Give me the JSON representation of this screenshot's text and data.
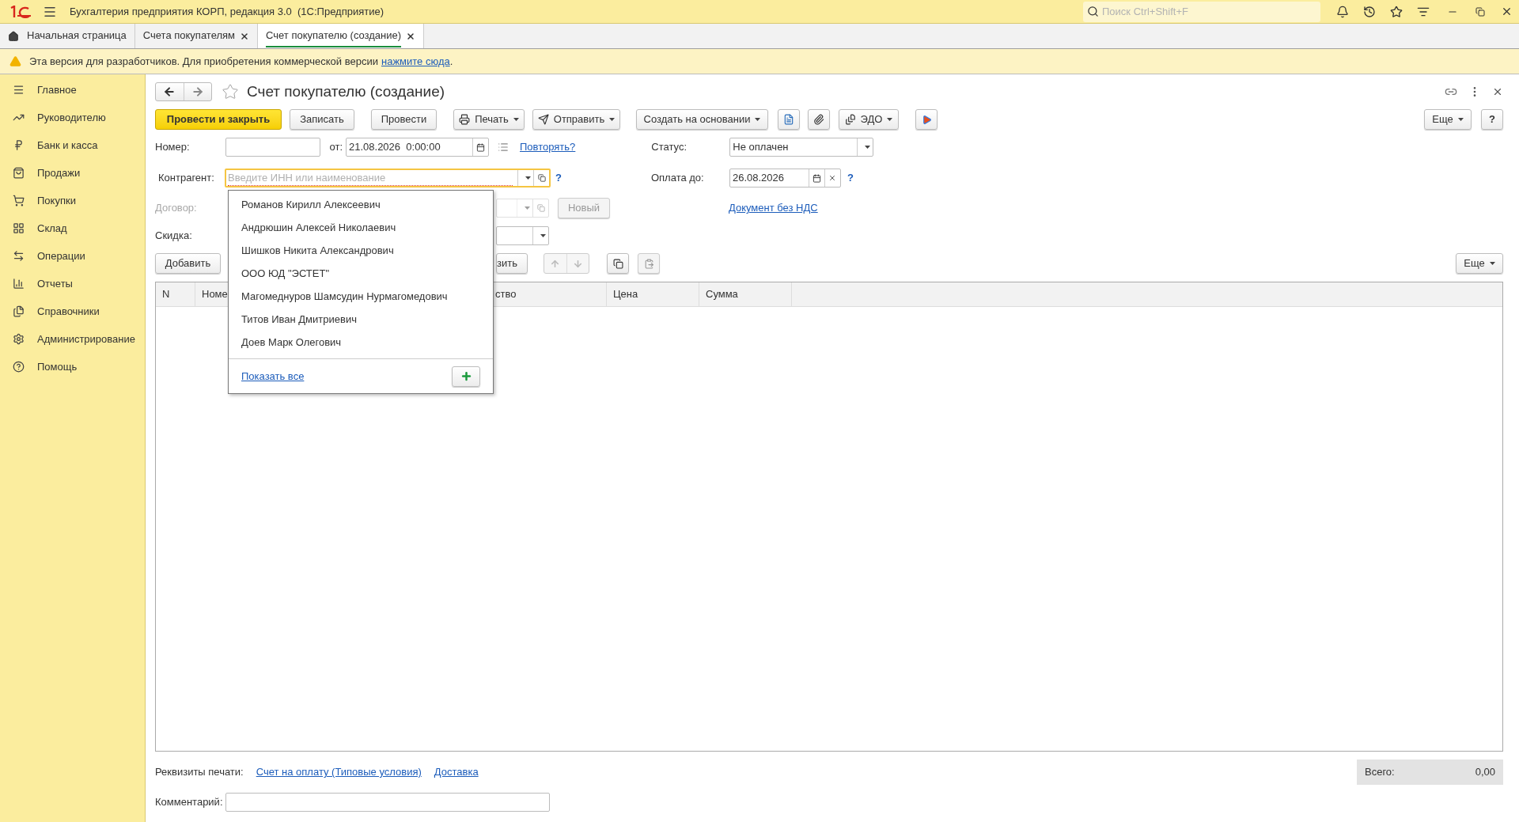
{
  "app": {
    "title": "Бухгалтерия предприятия КОРП, редакция 3.0  (1С:Предприятие)",
    "search": {
      "placeholder": "Поиск Ctrl+Shift+F"
    }
  },
  "tabs": [
    {
      "label": "Начальная страница",
      "selected": false,
      "closable": false
    },
    {
      "label": "Счета покупателям",
      "selected": false,
      "closable": true
    },
    {
      "label": "Счет покупателю (создание)",
      "selected": true,
      "closable": true
    }
  ],
  "notice": {
    "text": "Эта версия для разработчиков. Для приобретения коммерческой версии",
    "link": "нажмите сюда",
    "end": "."
  },
  "sidebar": {
    "items": [
      {
        "label": "Главное"
      },
      {
        "label": "Руководителю"
      },
      {
        "label": "Банк и касса"
      },
      {
        "label": "Продажи"
      },
      {
        "label": "Покупки"
      },
      {
        "label": "Склад"
      },
      {
        "label": "Операции"
      },
      {
        "label": "Отчеты"
      },
      {
        "label": "Справочники"
      },
      {
        "label": "Администрирование"
      },
      {
        "label": "Помощь"
      }
    ]
  },
  "form": {
    "title": "Счет покупателю (создание)",
    "toolbar": [
      {
        "label": "Провести и закрыть",
        "kind": "primary"
      },
      {
        "label": "Записать",
        "kind": "plain"
      },
      {
        "label": "Провести",
        "kind": "plain"
      },
      {
        "label": "Печать",
        "kind": "menu"
      },
      {
        "label": "Отправить",
        "kind": "menu"
      },
      {
        "label": "Создать на основании",
        "kind": "menu"
      },
      {
        "label": "ЭДО",
        "kind": "menu"
      }
    ],
    "more_button": "Еще",
    "help_button": "?",
    "number": {
      "label": "Номер:",
      "from_label": "от:",
      "date": "21.08.2026  0:00:00",
      "repeat_link": "Повторять?"
    },
    "status": {
      "label": "Статус:",
      "value": "Не оплачен"
    },
    "counterparty": {
      "label": "Контрагент:",
      "placeholder": "Введите ИНН или наименование",
      "focused": true,
      "help": "?"
    },
    "pay_until": {
      "label": "Оплата до:",
      "value": "26.08.2026",
      "help": "?"
    },
    "contract": {
      "label": "Договор:",
      "disabled": true,
      "new_button": "Новый"
    },
    "vat_link": "Документ без НДС",
    "discount": {
      "label": "Скидка:"
    },
    "table_toolbar": {
      "add_button": "Добавить",
      "button_2": "зить",
      "more_button": "Еще"
    },
    "table": {
      "columns": [
        "N",
        "Номе",
        "ство",
        "Цена",
        "Сумма"
      ]
    },
    "print_details": {
      "label": "Реквизиты печати:",
      "links": [
        "Счет на оплату (Типовые условия)",
        "Доставка"
      ]
    },
    "total": {
      "label": "Всего:",
      "value": "0,00"
    },
    "comment": {
      "label": "Комментарий:"
    }
  },
  "dropdown": {
    "items": [
      "Романов Кирилл Алексеевич",
      "Андрюшин Алексей Николаевич",
      "Шишков Никита Александрович",
      "ООО ЮД \"ЭСТЕТ\"",
      "Магомеднуров Шамсудин Нурмагомедович",
      "Титов Иван Дмитриевич",
      "Доев Марк Олегович"
    ],
    "show_all": "Показать все"
  }
}
